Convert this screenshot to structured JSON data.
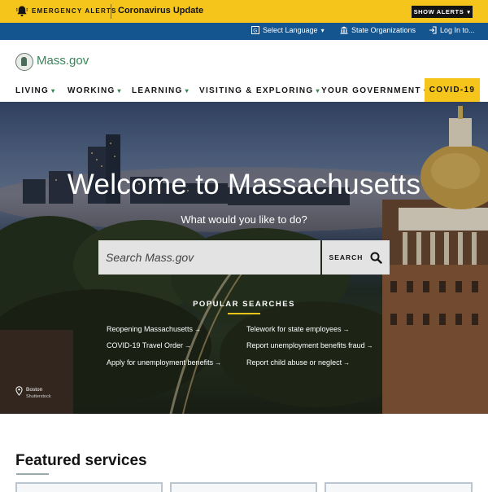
{
  "alert_bar": {
    "label": "EMERGENCY ALERTS",
    "title": "Coronavirus Update",
    "button": "SHOW ALERTS",
    "bg_color": "#f6c51b"
  },
  "utility_bar": {
    "language": "Select Language",
    "organizations": "State Organizations",
    "login": "Log In to...",
    "bg_color": "#14558f"
  },
  "header": {
    "logo_text": "Mass.gov",
    "nav": [
      {
        "label": "LIVING"
      },
      {
        "label": "WORKING"
      },
      {
        "label": "LEARNING"
      },
      {
        "label": "VISITING & EXPLORING"
      },
      {
        "label": "YOUR GOVERNMENT"
      }
    ],
    "covid_label": "COVID-19"
  },
  "hero": {
    "title": "Welcome to Massachusetts",
    "subtitle": "What would you like to do?",
    "search_placeholder": "Search Mass.gov",
    "search_button": "SEARCH",
    "popular_title": "POPULAR SEARCHES",
    "popular_left": [
      "Reopening Massachusetts",
      "COVID-19 Travel Order",
      "Apply for unemployment benefits"
    ],
    "popular_right": [
      "Telework for state employees",
      "Report unemployment benefits fraud",
      "Report child abuse or neglect"
    ],
    "location": "Boston",
    "credit": "Shutterstock"
  },
  "featured": {
    "title": "Featured services"
  },
  "icons": {
    "alert": "bell-icon",
    "language": "translate-icon",
    "organizations": "building-icon",
    "login": "login-icon",
    "search": "search-icon",
    "location": "map-pin-icon"
  }
}
